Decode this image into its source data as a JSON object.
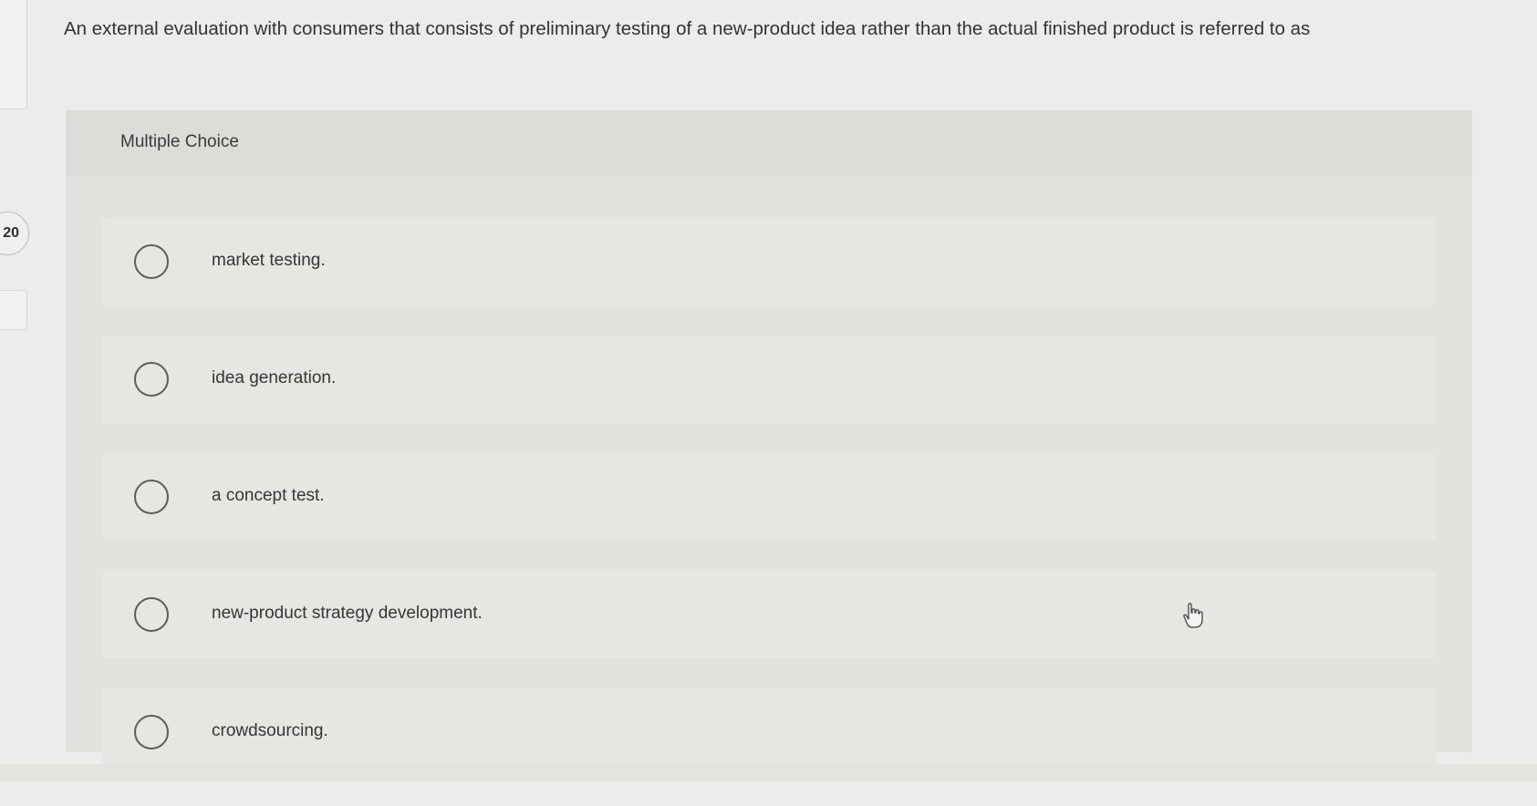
{
  "sidebar": {
    "question_number": "20"
  },
  "question": {
    "text": "An external evaluation with consumers that consists of preliminary testing of a new-product idea rather than the actual finished product is referred to as"
  },
  "choice_block": {
    "header": "Multiple Choice",
    "options": [
      {
        "label": "market testing."
      },
      {
        "label": "idea generation."
      },
      {
        "label": "a concept test."
      },
      {
        "label": "new-product strategy development."
      },
      {
        "label": "crowdsourcing."
      }
    ]
  },
  "icons": {
    "radio": "radio-circle",
    "cursor": "hand-pointer-icon"
  },
  "colors": {
    "background": "#ececea",
    "panel": "#e2e2df",
    "header": "#dcdcd9",
    "text": "#333333"
  }
}
